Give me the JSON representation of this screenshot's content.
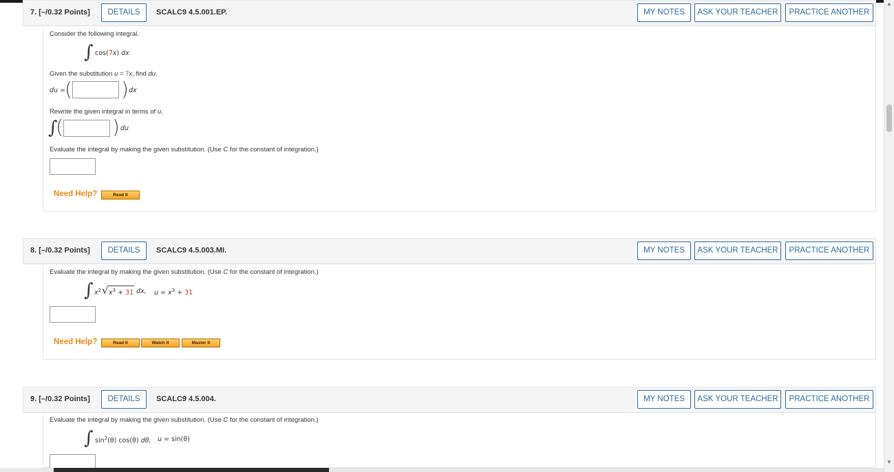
{
  "questions": [
    {
      "number": "7.",
      "points": "[–/0.32 Points]",
      "details_label": "DETAILS",
      "code": "SCALC9 4.5.001.EP.",
      "buttons": [
        "MY NOTES",
        "ASK YOUR TEACHER",
        "PRACTICE ANOTHER"
      ],
      "intro": "Consider the following integral.",
      "integrand_func": "cos(",
      "integrand_coef": "7",
      "integrand_var": "x",
      "integrand_close": ")",
      "integrand_dx": "dx",
      "given_pre": "Given the substitution ",
      "given_u": "u",
      "given_eq": " = ",
      "given_coef": "7",
      "given_x": "x",
      "given_post": ", find ",
      "given_du": "du",
      "given_end": ".",
      "du_label": "du",
      "du_eq": " =",
      "du_suffix": "dx",
      "rewrite_pre": "Rewrite the given integral in terms of ",
      "rewrite_u": "u",
      "rewrite_end": ".",
      "rewrite_suffix": "du",
      "evaluate_pre": "Evaluate the integral by making the given substitution. (Use ",
      "evaluate_c": "C",
      "evaluate_post": " for the constant of integration.)",
      "need_help": "Need Help?",
      "help_buttons": [
        "Read It"
      ]
    },
    {
      "number": "8.",
      "points": "[–/0.32 Points]",
      "details_label": "DETAILS",
      "code": "SCALC9 4.5.003.MI.",
      "buttons": [
        "MY NOTES",
        "ASK YOUR TEACHER",
        "PRACTICE ANOTHER"
      ],
      "evaluate_pre": "Evaluate the integral by making the given substitution. (Use ",
      "evaluate_c": "C",
      "evaluate_post": " for the constant of integration.)",
      "integrand_x": "x",
      "integrand_exp": "2",
      "radicand_x": "x",
      "radicand_exp": "3",
      "radicand_plus": " + ",
      "radicand_const": "31",
      "integrand_dx": "dx,",
      "sub_u": "u",
      "sub_eq": " = ",
      "sub_x": "x",
      "sub_exp": "3",
      "sub_plus": " + ",
      "sub_const": "31",
      "need_help": "Need Help?",
      "help_buttons": [
        "Read It",
        "Watch It",
        "Master It"
      ]
    },
    {
      "number": "9.",
      "points": "[–/0.32 Points]",
      "details_label": "DETAILS",
      "code": "SCALC9 4.5.004.",
      "buttons": [
        "MY NOTES",
        "ASK YOUR TEACHER",
        "PRACTICE ANOTHER"
      ],
      "evaluate_pre": "Evaluate the integral by making the given substitution. (Use ",
      "evaluate_c": "C",
      "evaluate_post": " for the constant of integration.)",
      "integrand_sin": "sin",
      "integrand_exp": "2",
      "integrand_theta1": "(θ) cos(θ) ",
      "integrand_dtheta": "dθ,",
      "sub_u": "u",
      "sub_rest": " = sin(θ)"
    }
  ]
}
